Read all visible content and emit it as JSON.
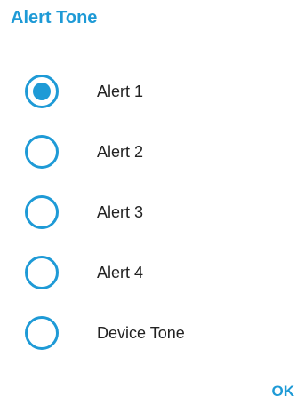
{
  "dialog": {
    "title": "Alert Tone",
    "options": [
      {
        "label": "Alert 1",
        "selected": true
      },
      {
        "label": "Alert 2",
        "selected": false
      },
      {
        "label": "Alert 3",
        "selected": false
      },
      {
        "label": "Alert 4",
        "selected": false
      },
      {
        "label": "Device Tone",
        "selected": false
      }
    ],
    "ok_label": "OK"
  },
  "colors": {
    "accent": "#1e9ad6",
    "text": "#222222",
    "background": "#ffffff"
  },
  "icons": {
    "radio_selected": "radio-selected-icon",
    "radio_unselected": "radio-unselected-icon"
  }
}
